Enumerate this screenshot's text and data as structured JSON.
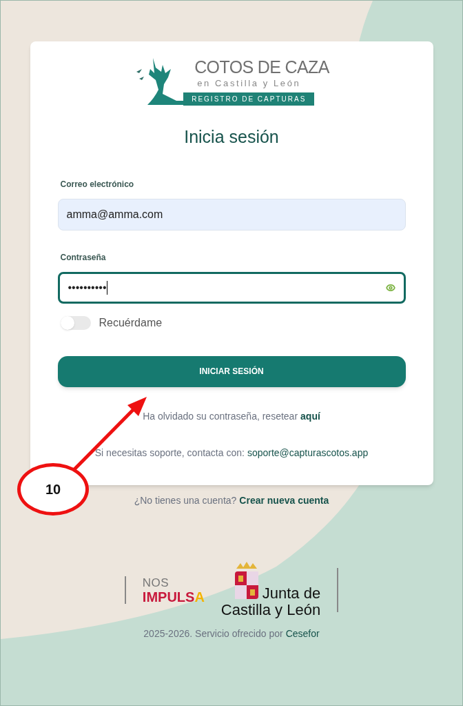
{
  "logo": {
    "title": "COTOS DE CAZA",
    "subtitle": "en Castilla y León",
    "banner": "REGISTRO DE CAPTURAS"
  },
  "heading": "Inicia sesión",
  "fields": [
    {
      "label": "Correo electrónico",
      "value": "amma@amma.com",
      "kind": "email",
      "focused": false
    },
    {
      "label": "Contraseña",
      "value": "••••••••••",
      "kind": "password",
      "focused": true
    }
  ],
  "remember": {
    "label": "Recuérdame",
    "on": false
  },
  "submit": "INICIAR SESIÓN",
  "forgot": {
    "text": "Ha olvidado su contraseña, resetear",
    "link": "aquí"
  },
  "support": {
    "text": "Si necesitas soporte, contacta con:",
    "link": "soporte@capturascotos.app"
  },
  "signup": {
    "text": "¿No tienes una cuenta?",
    "link": "Crear nueva cuenta"
  },
  "sponsors": {
    "nos": "NOS",
    "impulsa": "IMPULSA",
    "junta": "Junta de",
    "region": "Castilla y León"
  },
  "footer": {
    "text": "2025-2026. Servicio ofrecido por",
    "link": "Cesefor"
  },
  "annotation": {
    "label": "10"
  }
}
